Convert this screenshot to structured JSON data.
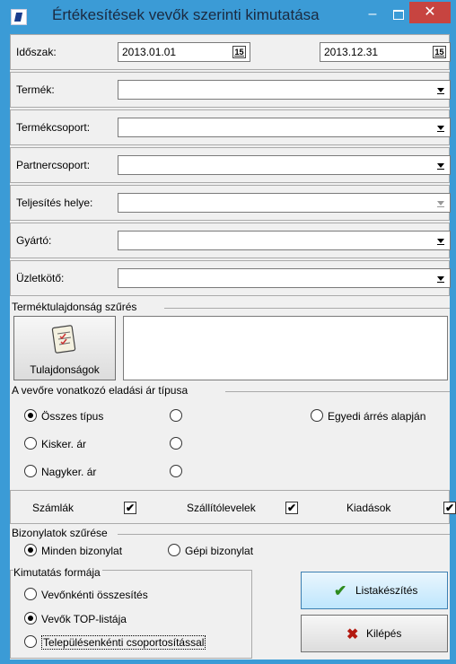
{
  "window": {
    "title": "Értékesítések vevők szerinti kimutatása",
    "min": "–",
    "close": "✕"
  },
  "period": {
    "label": "Időszak:",
    "from": "2013.01.01",
    "to": "2013.12.31",
    "cal_glyph": "15"
  },
  "filters": [
    {
      "label": "Termék:",
      "value": ""
    },
    {
      "label": "Termékcsoport:",
      "value": ""
    },
    {
      "label": "Partnercsoport:",
      "value": ""
    },
    {
      "label": "Teljesítés helye:",
      "value": ""
    },
    {
      "label": "Gyártó:",
      "value": ""
    },
    {
      "label": "Üzletkötő:",
      "value": ""
    }
  ],
  "property_filter": {
    "title": "Terméktulajdonság szűrés",
    "button": "Tulajdonságok"
  },
  "price_type": {
    "title": "A vevőre vonatkozó eladási ár típusa",
    "options": [
      "Összes típus",
      "Kisker. ár",
      "Nagyker. ár",
      "Egyedi árrés alapján"
    ],
    "selected": "Összes típus"
  },
  "checks": {
    "szamlak": "Számlák",
    "szallito": "Szállítólevelek",
    "kiadasok": "Kiadások",
    "mark": "✔"
  },
  "doc_filter": {
    "title": "Bizonylatok szűrése",
    "opt1": "Minden bizonylat",
    "opt2": "Gépi bizonylat"
  },
  "format": {
    "title": "Kimutatás formája",
    "opt1": "Vevőnkénti összesítés",
    "opt2": "Vevők TOP-listája",
    "opt3": "Településenkénti csoportosítással"
  },
  "actions": {
    "list": "Listakészítés",
    "list_icon": "✔",
    "exit": "Kilépés",
    "exit_icon": "✖"
  },
  "colors": {
    "titlebar": "#3b9bd6",
    "close": "#c74440",
    "ok_green": "#2e8b1e",
    "exit_red": "#b3180f"
  }
}
